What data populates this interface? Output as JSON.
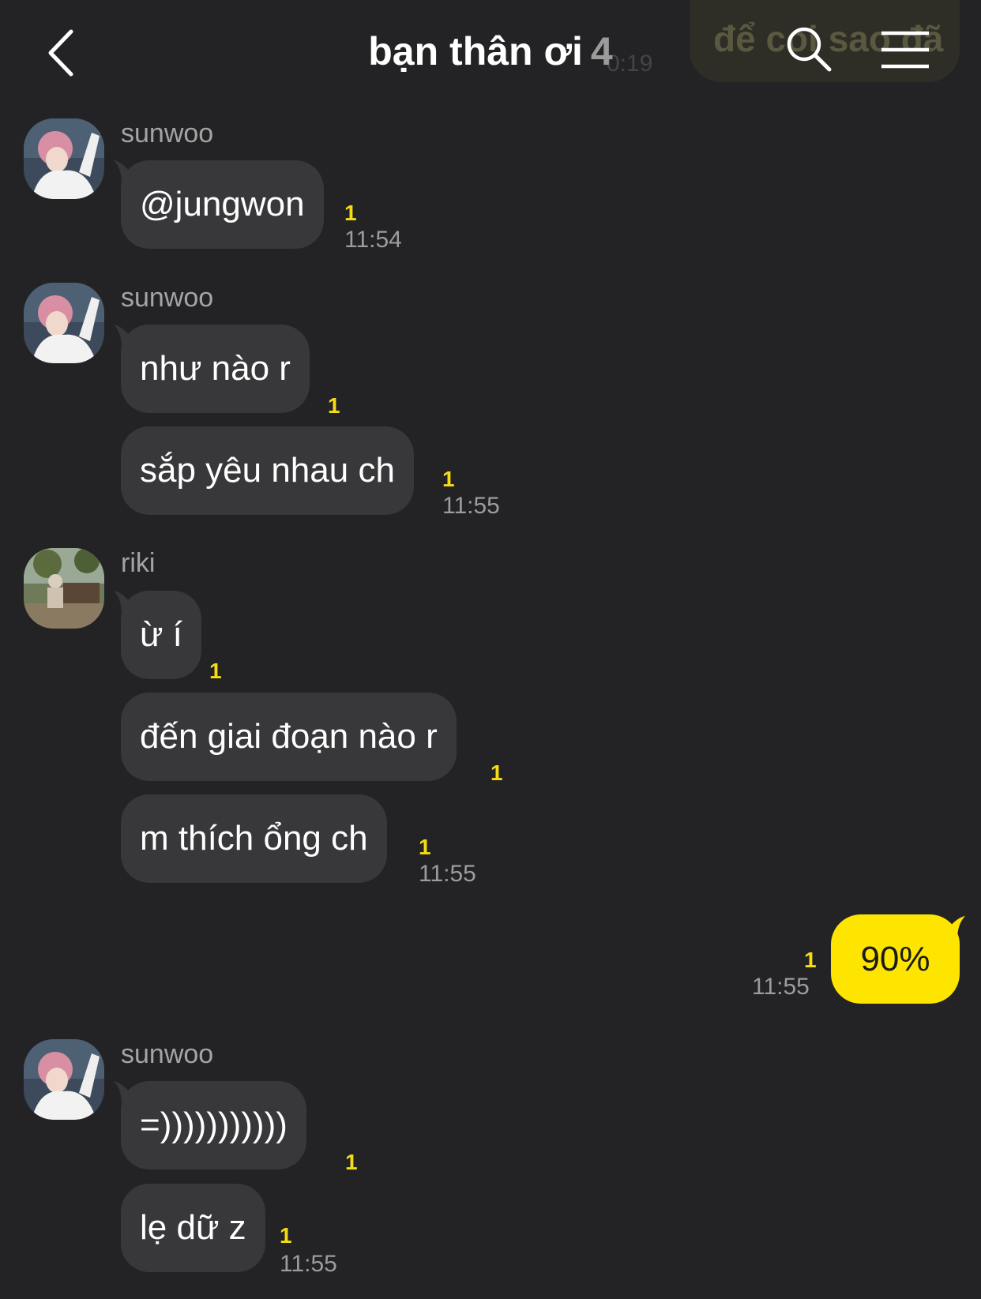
{
  "header": {
    "back_icon": "chevron-left-icon",
    "title": "bạn thân ơi",
    "member_count": "4",
    "ghost_time": "0:19",
    "preview_text": "để coi sao đã",
    "search_icon": "search-icon",
    "menu_icon": "menu-icon"
  },
  "messages": [
    {
      "sender": "sunwoo",
      "text": "@jungwon",
      "unread": "1",
      "time": "11:54"
    },
    {
      "sender": "sunwoo",
      "text": "như nào r",
      "unread": "1"
    },
    {
      "text": "sắp yêu nhau ch",
      "unread": "1",
      "time": "11:55"
    },
    {
      "sender": "riki",
      "text": "ừ í",
      "unread": "1"
    },
    {
      "text": "đến giai đoạn nào r",
      "unread": "1"
    },
    {
      "text": "m thích ổng ch",
      "unread": "1",
      "time": "11:55"
    },
    {
      "mine": true,
      "text": "90%",
      "unread": "1",
      "time": "11:55"
    },
    {
      "sender": "sunwoo",
      "text": "=)))))))))))",
      "unread": "1"
    },
    {
      "text": "lẹ dữ z",
      "unread": "1",
      "time": "11:55"
    }
  ],
  "colors": {
    "background": "#232325",
    "bubble_other": "#38383a",
    "bubble_mine": "#fee500",
    "unread": "#f5dc13"
  }
}
